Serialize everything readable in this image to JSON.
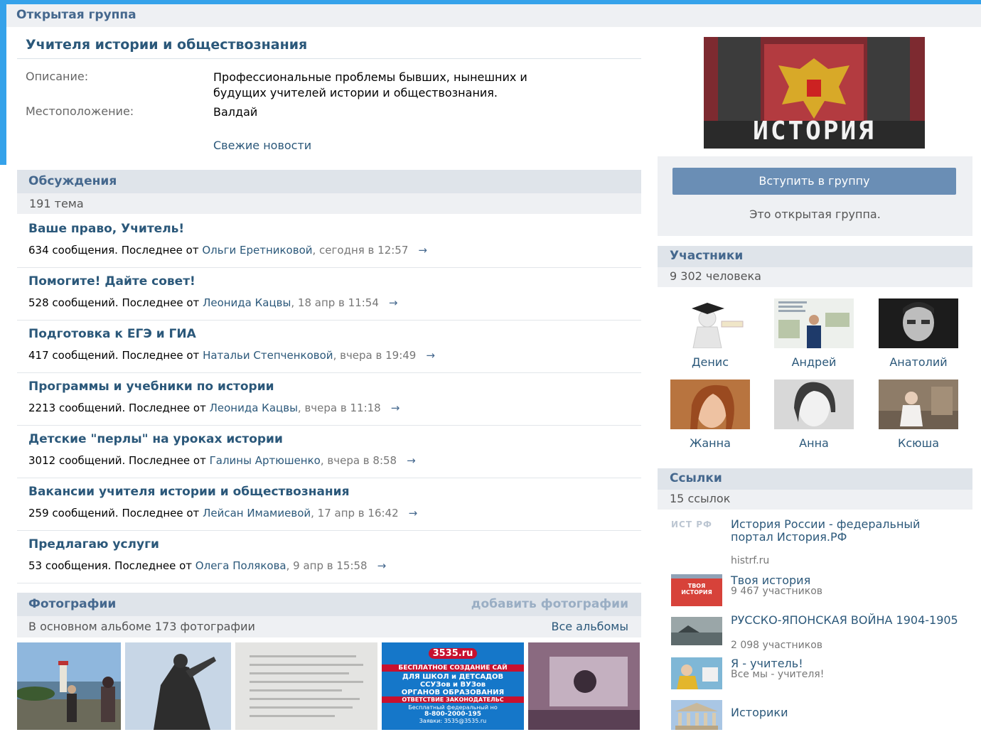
{
  "header": {
    "title": "Открытая группа"
  },
  "group": {
    "name": "Учителя истории и обществознания",
    "description_label": "Описание:",
    "description_line1": "Профессиональные проблемы бывших, нынешних и",
    "description_line2": "будущих учителей истории и обществознания.",
    "location_label": "Местоположение:",
    "location": "Валдай",
    "fresh_news": "Свежие новости"
  },
  "discussions": {
    "title": "Обсуждения",
    "count": "191 тема",
    "topics": [
      {
        "title": "Ваше право, Учитель!",
        "count": "634 сообщения. Последнее от ",
        "author": "Ольги Еретниковой",
        "time": ", сегодня в 12:57",
        "arrow": "→"
      },
      {
        "title": "Помогите! Дайте совет!",
        "count": "528 сообщений. Последнее от ",
        "author": "Леонида Кацвы",
        "time": ", 18 апр в 11:54",
        "arrow": "→"
      },
      {
        "title": "Подготовка к ЕГЭ и ГИА",
        "count": "417 сообщений. Последнее от ",
        "author": "Натальи Степченковой",
        "time": ", вчера в 19:49",
        "arrow": "→"
      },
      {
        "title": "Программы и учебники по истории",
        "count": "2213 сообщений. Последнее от ",
        "author": "Леонида Кацвы",
        "time": ", вчера в 11:18",
        "arrow": "→"
      },
      {
        "title": "Детские \"перлы\" на уроках истории",
        "count": "3012 сообщений. Последнее от ",
        "author": "Галины Артюшенко",
        "time": ", вчера в 8:58",
        "arrow": "→"
      },
      {
        "title": "Вакансии учителя истории и обществознания",
        "count": "259 сообщений. Последнее от ",
        "author": "Лейсан Имамиевой",
        "time": ", 17 апр в 16:42",
        "arrow": "→"
      },
      {
        "title": "Предлагаю услуги",
        "count": "53 сообщения. Последнее от ",
        "author": "Олега Полякова",
        "time": ", 9 апр в 15:58",
        "arrow": "→"
      }
    ]
  },
  "photos": {
    "title": "Фотографии",
    "add": "добавить фотографии",
    "album_info": "В основном альбоме 173 фотографии",
    "all_albums": "Все альбомы",
    "poster_text": {
      "site": "3535.ru",
      "l1": "БЕСПЛАТНОЕ СОЗДАНИЕ САЙ",
      "l2": "ДЛЯ ШКОЛ и ДЕТСАДОВ",
      "l3": "ССУЗов и ВУЗов",
      "l4": "ОРГАНОВ ОБРАЗОВАНИЯ",
      "l5": "ОТВЕТСТВИЕ ЗАКОНОДАТЕЛЬС",
      "l6": "Бесплатный федеральный но",
      "l7": "8-800-2000-195",
      "l8": "Заявки: 3535@3535.ru"
    }
  },
  "sidebar": {
    "avatar_text": "ИСТОРИЯ",
    "join_button": "Вступить в группу",
    "join_note": "Это открытая группа.",
    "members_title": "Участники",
    "members_count": "9 302 человека",
    "members": [
      {
        "name": "Денис"
      },
      {
        "name": "Андрей"
      },
      {
        "name": "Анатолий"
      },
      {
        "name": "Жанна"
      },
      {
        "name": "Анна"
      },
      {
        "name": "Ксюша"
      }
    ],
    "links_title": "Ссылки",
    "links_count": "15 ссылок",
    "links": [
      {
        "title": "История России - федеральный портал История.РФ",
        "sub": "histrf.ru",
        "thumb_text": "РФ"
      },
      {
        "title": "Твоя история",
        "sub": "9 467 участников",
        "thumb_text": "ТВОЯ ИСТОРИЯ"
      },
      {
        "title": "РУССКО-ЯПОНСКАЯ ВОЙНА 1904-1905",
        "sub": "2 098 участников"
      },
      {
        "title": "Я - учитель!",
        "sub": "Все мы - учителя!"
      },
      {
        "title": "Историки",
        "sub": ""
      }
    ]
  }
}
